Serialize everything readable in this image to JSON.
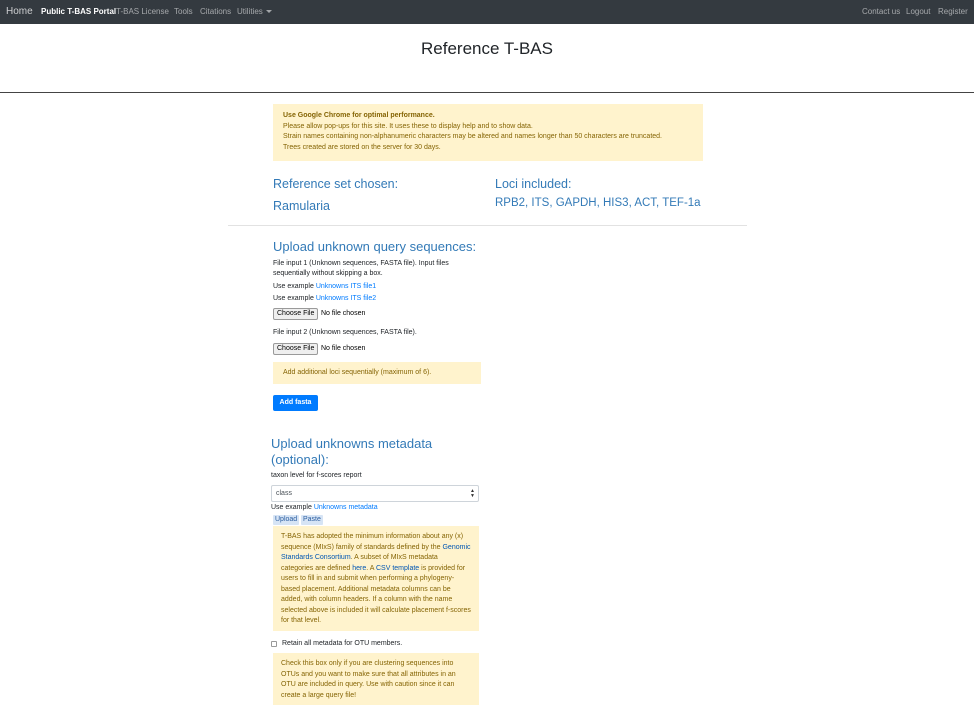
{
  "nav": {
    "home": "Home",
    "items": [
      "Public T-BAS Portal",
      "T-BAS License",
      "Tools",
      "Citations",
      "Utilities"
    ],
    "right": [
      "Contact us",
      "Logout",
      "Register"
    ]
  },
  "page_title": "Reference T-BAS",
  "notice": {
    "line1": "Use Google Chrome for optimal performance.",
    "line2": "Please allow pop-ups for this site. It uses these to display help and to show data.",
    "line3": "Strain names containing non-alphanumeric characters may be altered and names longer than 50 characters are truncated.",
    "line4": "Trees created are stored on the server for 30 days."
  },
  "reference": {
    "label": "Reference set chosen:",
    "value": "Ramularia",
    "loci_label": "Loci included:",
    "loci_value": "RPB2, ITS, GAPDH, HIS3, ACT, TEF-1a"
  },
  "upload": {
    "heading": "Upload unknown query sequences:",
    "input1_desc": "File input 1 (Unknown sequences, FASTA file). Input files sequentially without skipping a box.",
    "use_example": "Use example",
    "example1": "Unknowns ITS file1",
    "example2": "Unknowns ITS file2",
    "choose_file": "Choose File",
    "no_file": "No file chosen",
    "input2_desc": "File input 2 (Unknown sequences, FASTA file).",
    "add_loci_note": "Add additional loci sequentially (maximum of 6).",
    "add_fasta": "Add fasta"
  },
  "metadata": {
    "heading": "Upload unknowns metadata (optional):",
    "taxon_label": "taxon level for f-scores report",
    "taxon_value": "class",
    "use_example": "Use example",
    "example_link": "Unknowns metadata",
    "tab_upload": "Upload",
    "tab_paste": "Paste",
    "info_a": "T-BAS has adopted the minimum information about any (x) sequence (MIxS) family of standards defined by the",
    "info_gsc": "Genomic Standards Consortium",
    "info_b": ". A subset of MIxS metadata categories are defined",
    "info_here": "here",
    "info_c": ". A",
    "info_csv": "CSV template",
    "info_d": "is provided for users to fill in and submit when performing a phylogeny-based placement. Additional metadata columns can be added, with column headers. If a column with the name selected above is included it will calculate placement f-scores for that level.",
    "retain_label": "Retain all metadata for OTU members.",
    "retain_note": "Check this box only if you are clustering sequences into OTUs and you want to make sure that all attributes in an OTU are included in query. Use with caution since it can create a large query file!"
  },
  "colors": {
    "navbar": "#343a40",
    "accent": "#337ab7",
    "alert_bg": "#fff3cd",
    "alert_text": "#856404",
    "primary_button": "#007bff"
  }
}
